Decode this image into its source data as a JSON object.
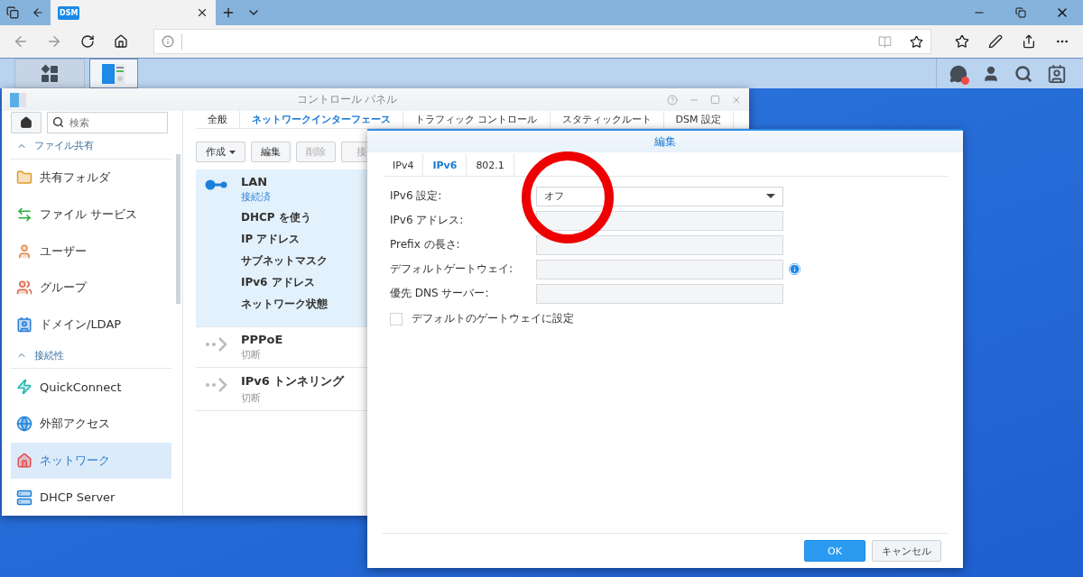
{
  "browser": {
    "tab": {
      "favicon": "DSM",
      "selected": true
    }
  },
  "taskbar": {
    "apps": [
      {
        "selected": false
      },
      {
        "selected": true
      }
    ],
    "notification": true
  },
  "control_panel": {
    "title": "コントロール パネル",
    "sidebar": {
      "search": {
        "placeholder": "検索"
      },
      "sections": [
        {
          "title": "ファイル共有",
          "expanded": true,
          "items": [
            {
              "label": "共有フォルダ",
              "selected": false
            },
            {
              "label": "ファイル サービス",
              "selected": false
            },
            {
              "label": "ユーザー",
              "selected": false
            },
            {
              "label": "グループ",
              "selected": false
            },
            {
              "label": "ドメイン/LDAP",
              "selected": false
            }
          ]
        },
        {
          "title": "接続性",
          "expanded": true,
          "items": [
            {
              "label": "QuickConnect",
              "selected": false
            },
            {
              "label": "外部アクセス",
              "selected": false
            },
            {
              "label": "ネットワーク",
              "selected": true
            },
            {
              "label": "DHCP Server",
              "selected": false
            }
          ]
        }
      ]
    },
    "tabs": [
      {
        "label": "全般",
        "selected": false
      },
      {
        "label": "ネットワークインターフェース",
        "selected": true
      },
      {
        "label": "トラフィック コントロール",
        "selected": false
      },
      {
        "label": "スタティックルート",
        "selected": false
      },
      {
        "label": "DSM 設定",
        "selected": false
      }
    ],
    "toolbar": [
      {
        "label": "作成",
        "dropdown": true,
        "disabled": false
      },
      {
        "label": "編集",
        "dropdown": false,
        "disabled": false
      },
      {
        "label": "削除",
        "dropdown": false,
        "disabled": true
      },
      {
        "label": "接",
        "dropdown": false,
        "disabled": true
      }
    ],
    "interfaces": [
      {
        "name": "LAN",
        "status": "接続済",
        "connected": true,
        "selected": true,
        "details": [
          "DHCP を使う",
          "IP アドレス",
          "サブネットマスク",
          "IPv6 アドレス",
          "ネットワーク状態"
        ]
      },
      {
        "name": "PPPoE",
        "status": "切断",
        "connected": false,
        "selected": false
      },
      {
        "name": "IPv6 トンネリング",
        "status": "切断",
        "connected": false,
        "selected": false
      }
    ]
  },
  "dialog": {
    "title": "編集",
    "tabs": [
      {
        "label": "IPv4",
        "selected": false
      },
      {
        "label": "IPv6",
        "selected": true
      },
      {
        "label": "802.1",
        "selected": false
      }
    ],
    "fields": [
      {
        "kind": "select",
        "label": "IPv6 設定:",
        "value": "オフ",
        "disabled": false,
        "info": false
      },
      {
        "kind": "input",
        "label": "IPv6 アドレス:",
        "disabled": true,
        "info": false
      },
      {
        "kind": "input",
        "label": "Prefix の長さ:",
        "disabled": true,
        "info": false
      },
      {
        "kind": "input",
        "label": "デフォルトゲートウェイ:",
        "disabled": true,
        "info": true
      },
      {
        "kind": "input",
        "label": "優先 DNS サーバー:",
        "disabled": true,
        "info": false
      }
    ],
    "checkbox": {
      "label": "デフォルトのゲートウェイに設定",
      "checked": false
    },
    "buttons": [
      {
        "label": "OK",
        "primary": true
      },
      {
        "label": "キャンセル",
        "primary": false
      }
    ]
  },
  "annotation": {
    "kind": "circle",
    "color": "#ee0000"
  }
}
